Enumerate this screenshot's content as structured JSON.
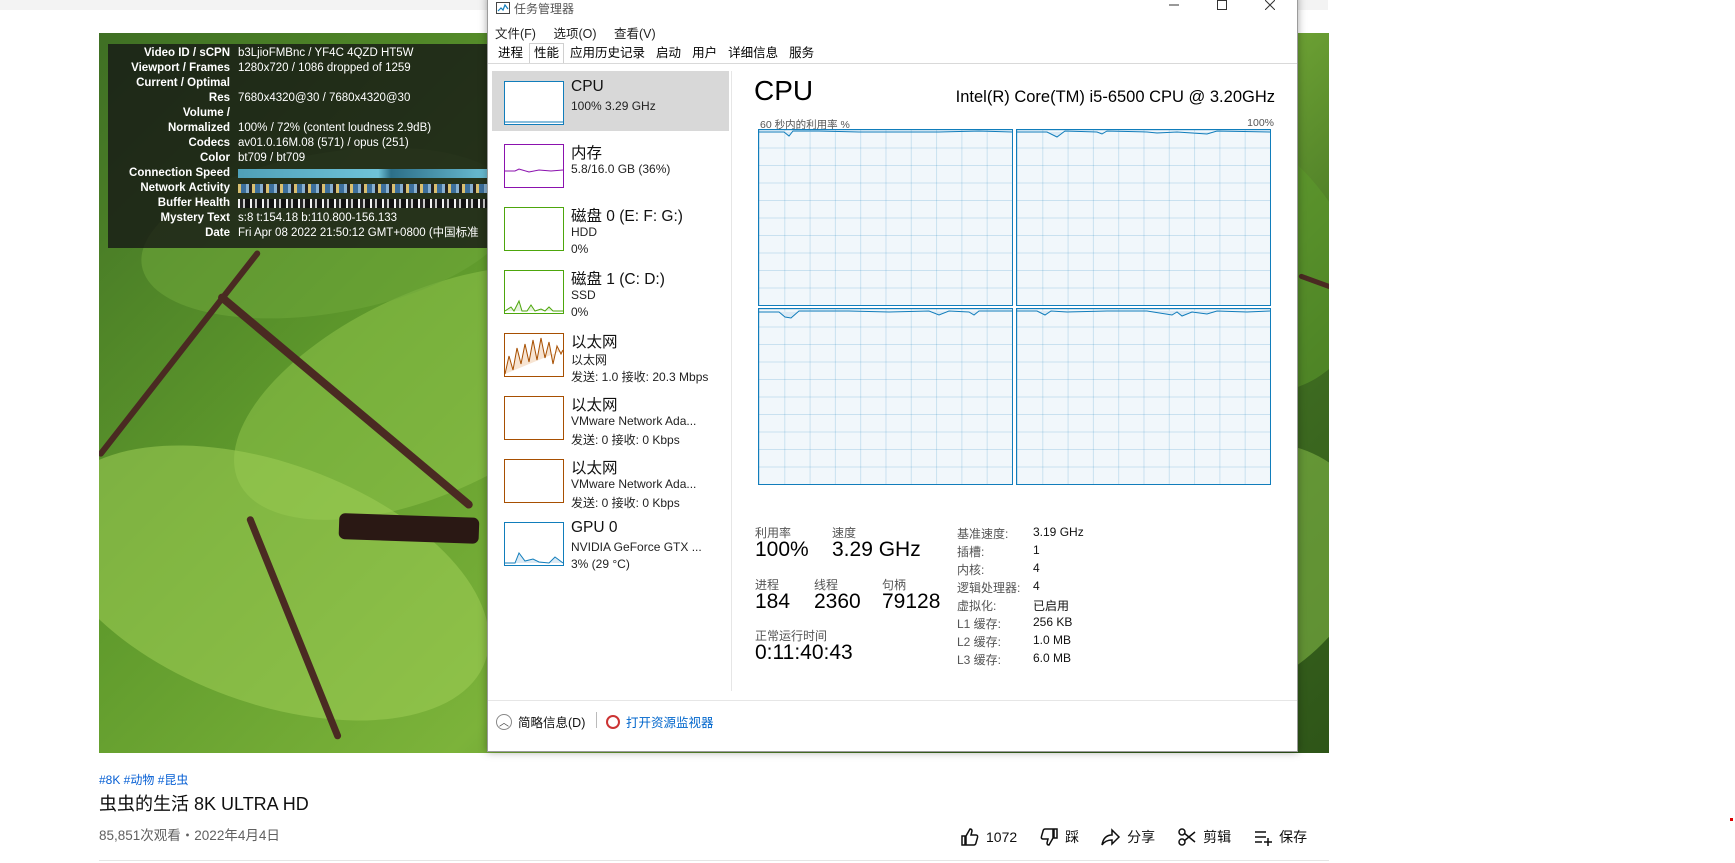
{
  "stats": {
    "rows": [
      {
        "k": "Video ID / sCPN",
        "v": "b3LjioFMBnc / YF4C 4QZD HT5W"
      },
      {
        "k": "Viewport / Frames",
        "v": "1280x720 / 1086 dropped of 1259"
      },
      {
        "k": "Current / Optimal",
        "v": ""
      },
      {
        "k": "Res",
        "v": "7680x4320@30 / 7680x4320@30"
      },
      {
        "k": "Volume /",
        "v": ""
      },
      {
        "k": "Normalized",
        "v": "100% / 72% (content loudness 2.9dB)"
      },
      {
        "k": "Codecs",
        "v": "av01.0.16M.08 (571) / opus (251)"
      },
      {
        "k": "Color",
        "v": "bt709 / bt709"
      },
      {
        "k": "Connection Speed",
        "v": ""
      },
      {
        "k": "Network Activity",
        "v": ""
      },
      {
        "k": "Buffer Health",
        "v": ""
      },
      {
        "k": "Mystery Text",
        "v": "s:8 t:154.18 b:110.800-156.133"
      },
      {
        "k": "Date",
        "v": "Fri Apr 08 2022 21:50:12 GMT+0800 (中国标准"
      }
    ]
  },
  "video": {
    "tags": "#8K #动物 #昆虫",
    "title": "虫虫的生活 8K ULTRA HD",
    "meta": "85,851次观看・2022年4月4日",
    "actions": {
      "like": "1072",
      "dislike": "踩",
      "share": "分享",
      "clip": "剪辑",
      "save": "保存"
    }
  },
  "taskmanager": {
    "title": "任务管理器",
    "menu": [
      "文件(F)",
      "选项(O)",
      "查看(V)"
    ],
    "tabs": [
      "进程",
      "性能",
      "应用历史记录",
      "启动",
      "用户",
      "详细信息",
      "服务"
    ],
    "active_tab": "性能",
    "sidebar": [
      {
        "name": "CPU",
        "sub1": "100%  3.29 GHz",
        "sub2": "",
        "color": "#117dbb"
      },
      {
        "name": "内存",
        "sub1": "5.8/16.0 GB (36%)",
        "sub2": "",
        "color": "#8b12ae"
      },
      {
        "name": "磁盘 0 (E: F: G:)",
        "sub1": "HDD",
        "sub2": "0%",
        "color": "#4da60c"
      },
      {
        "name": "磁盘 1 (C: D:)",
        "sub1": "SSD",
        "sub2": "0%",
        "color": "#4da60c"
      },
      {
        "name": "以太网",
        "sub1": "以太网",
        "sub2": "发送: 1.0 接收: 20.3 Mbps",
        "color": "#a74f01"
      },
      {
        "name": "以太网",
        "sub1": "VMware Network Ada...",
        "sub2": "发送: 0 接收: 0 Kbps",
        "color": "#a74f01"
      },
      {
        "name": "以太网",
        "sub1": "VMware Network Ada...",
        "sub2": "发送: 0 接收: 0 Kbps",
        "color": "#a74f01"
      },
      {
        "name": "GPU 0",
        "sub1": "NVIDIA GeForce GTX ...",
        "sub2": "3% (29 °C)",
        "color": "#117dbb"
      }
    ],
    "cpu": {
      "heading": "CPU",
      "model": "Intel(R) Core(TM) i5-6500 CPU @ 3.20GHz",
      "graph_label_left": "60 秒内的利用率 %",
      "graph_label_right": "100%",
      "utilization_label": "利用率",
      "utilization": "100%",
      "speed_label": "速度",
      "speed": "3.29 GHz",
      "processes_label": "进程",
      "processes": "184",
      "threads_label": "线程",
      "threads": "2360",
      "handles_label": "句柄",
      "handles": "79128",
      "uptime_label": "正常运行时间",
      "uptime": "0:11:40:43",
      "specs": [
        {
          "k": "基准速度:",
          "v": "3.19 GHz"
        },
        {
          "k": "插槽:",
          "v": "1"
        },
        {
          "k": "内核:",
          "v": "4"
        },
        {
          "k": "逻辑处理器:",
          "v": "4"
        },
        {
          "k": "虚拟化:",
          "v": "已启用"
        },
        {
          "k": "L1 缓存:",
          "v": "256 KB"
        },
        {
          "k": "L2 缓存:",
          "v": "1.0 MB"
        },
        {
          "k": "L3 缓存:",
          "v": "6.0 MB"
        }
      ]
    },
    "footer": {
      "fewer_details": "简略信息(D)",
      "open_resmon": "打开资源监视器"
    }
  }
}
